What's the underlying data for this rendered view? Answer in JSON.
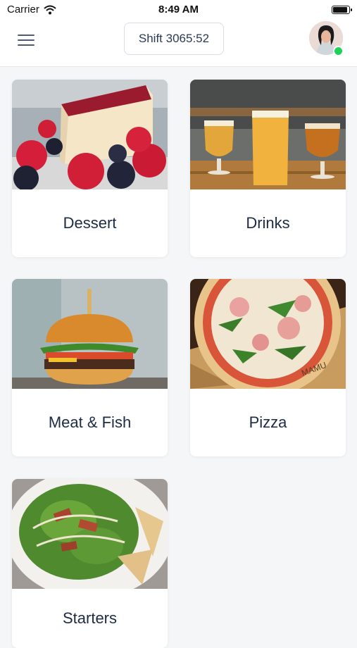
{
  "status_bar": {
    "carrier": "Carrier",
    "time": "8:49 AM"
  },
  "header": {
    "shift_label": "Shift 3065:52"
  },
  "categories": [
    {
      "label": "Dessert"
    },
    {
      "label": "Drinks"
    },
    {
      "label": "Meat & Fish"
    },
    {
      "label": "Pizza"
    },
    {
      "label": "Starters"
    }
  ],
  "colors": {
    "accent": "#1d2b44",
    "online": "#1fd35a"
  }
}
